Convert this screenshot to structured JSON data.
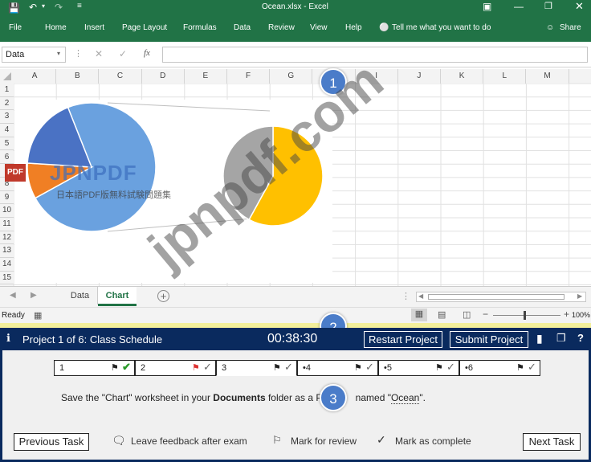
{
  "window": {
    "title": "Ocean.xlsx - Excel"
  },
  "ribbon": {
    "tabs": [
      "File",
      "Home",
      "Insert",
      "Page Layout",
      "Formulas",
      "Data",
      "Review",
      "View",
      "Help"
    ],
    "tell_me": "Tell me what you want to do",
    "share": "Share"
  },
  "formula_bar": {
    "name_box": "Data",
    "fx": "fx",
    "content": ""
  },
  "grid": {
    "columns": [
      "A",
      "B",
      "C",
      "D",
      "E",
      "F",
      "G",
      "H",
      "I",
      "J",
      "K",
      "L",
      "M"
    ],
    "rows": [
      "1",
      "2",
      "3",
      "4",
      "5",
      "6",
      "7",
      "8",
      "9",
      "10",
      "11",
      "12",
      "13",
      "14",
      "15"
    ]
  },
  "chart_data": {
    "type": "pie",
    "title": "",
    "main_pie": {
      "slices": [
        {
          "color": "#6aa1df",
          "value": 73
        },
        {
          "color": "#f07f24",
          "value": 9
        },
        {
          "color": "#4a72c4",
          "value": 18
        }
      ]
    },
    "sub_pie": {
      "slices": [
        {
          "color": "#ffc000",
          "value": 58
        },
        {
          "color": "#a5a5a5",
          "value": 42
        }
      ]
    }
  },
  "sheet_tabs": {
    "tabs": [
      "Data",
      "Chart"
    ],
    "active": "Chart"
  },
  "status": {
    "ready": "Ready",
    "zoom": "100%"
  },
  "exam": {
    "project": "Project 1 of 6: Class Schedule",
    "timer": "00:38:30",
    "restart": "Restart Project",
    "submit": "Submit Project",
    "tasks": [
      {
        "label": "1",
        "status": "complete"
      },
      {
        "label": "2",
        "status": "flagged"
      },
      {
        "label": "3",
        "status": "current"
      },
      {
        "label": "•4",
        "status": ""
      },
      {
        "label": "•5",
        "status": ""
      },
      {
        "label": "•6",
        "status": ""
      }
    ],
    "instruction_pre": "Save the \"Chart\" worksheet in your ",
    "instruction_bold": "Documents",
    "instruction_mid": " folder as a P",
    "instruction_post": " named \"",
    "instruction_name": "Ocean",
    "instruction_end": "\".",
    "previous": "Previous Task",
    "feedback": "Leave feedback after exam",
    "mark_review": "Mark for review",
    "mark_complete": "Mark as complete",
    "next": "Next Task"
  },
  "badges": [
    "1",
    "2",
    "3"
  ],
  "watermark": {
    "brand": "JPNPDF",
    "pdf": "PDF",
    "sub": "日本語PDF版無料試験問題集",
    "diag": "jpnpdf.com"
  },
  "colors": {
    "excel_green": "#217346",
    "exam_navy": "#0a2a5e",
    "badge_blue": "#4a7cc9"
  }
}
